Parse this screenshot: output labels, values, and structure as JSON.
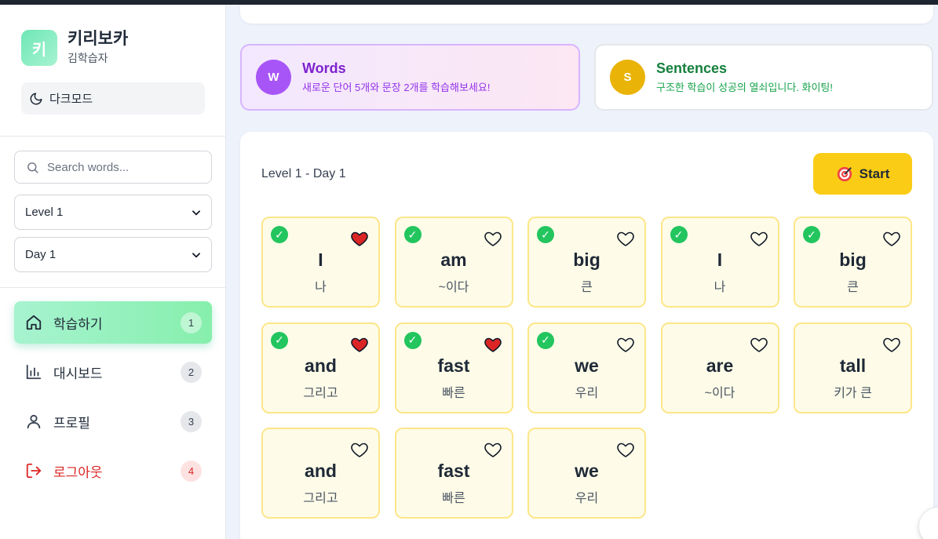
{
  "sidebar": {
    "logo_letter": "키",
    "app_title": "키리보카",
    "user_name": "김학습자",
    "darkmode_label": "다크모드",
    "search_placeholder": "Search words...",
    "level_select": "Level 1",
    "day_select": "Day 1",
    "nav": [
      {
        "label": "학습하기",
        "badge": "1",
        "icon": "home-icon"
      },
      {
        "label": "대시보드",
        "badge": "2",
        "icon": "bar-chart-icon"
      },
      {
        "label": "프로필",
        "badge": "3",
        "icon": "user-icon"
      },
      {
        "label": "로그아웃",
        "badge": "4",
        "icon": "logout-icon"
      }
    ]
  },
  "info_cards": {
    "words": {
      "avatar": "W",
      "title": "Words",
      "desc": "새로운 단어 5개와 문장 2개를 학습해보세요!",
      "color": "#a855f7"
    },
    "sentences": {
      "avatar": "S",
      "title": "Sentences",
      "desc": "구조한 학습이 성공의 열쇠입니다. 화이팅!",
      "color": "#eab308"
    }
  },
  "study": {
    "level_day": "Level 1 - Day 1",
    "start_label": "Start",
    "cards": [
      {
        "word": "I",
        "meaning": "나",
        "checked": true,
        "liked": true
      },
      {
        "word": "am",
        "meaning": "~이다",
        "checked": true,
        "liked": false
      },
      {
        "word": "big",
        "meaning": "큰",
        "checked": true,
        "liked": false
      },
      {
        "word": "I",
        "meaning": "나",
        "checked": true,
        "liked": false
      },
      {
        "word": "big",
        "meaning": "큰",
        "checked": true,
        "liked": false
      },
      {
        "word": "and",
        "meaning": "그리고",
        "checked": true,
        "liked": true
      },
      {
        "word": "fast",
        "meaning": "빠른",
        "checked": true,
        "liked": true
      },
      {
        "word": "we",
        "meaning": "우리",
        "checked": true,
        "liked": false
      },
      {
        "word": "are",
        "meaning": "~이다",
        "checked": false,
        "liked": false
      },
      {
        "word": "tall",
        "meaning": "키가 큰",
        "checked": false,
        "liked": false
      },
      {
        "word": "and",
        "meaning": "그리고",
        "checked": false,
        "liked": false
      },
      {
        "word": "fast",
        "meaning": "빠른",
        "checked": false,
        "liked": false
      },
      {
        "word": "we",
        "meaning": "우리",
        "checked": false,
        "liked": false
      }
    ]
  }
}
